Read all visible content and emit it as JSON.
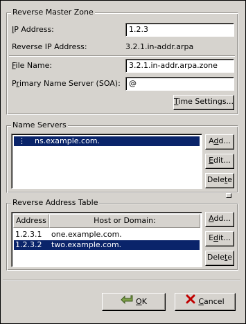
{
  "master_zone": {
    "title": "Reverse Master Zone",
    "ip_address": {
      "label_u": "I",
      "label_rest": "P Address:",
      "value": "1.2.3"
    },
    "reverse_ip": {
      "label": "Reverse IP Address:",
      "value": "3.2.1.in-addr.arpa"
    },
    "file_name": {
      "label_u": "F",
      "label_rest": "ile Name:",
      "value": "3.2.1.in-addr.arpa.zone"
    },
    "primary_ns": {
      "label_pre": "P",
      "label_u": "r",
      "label_rest": "imary Name Server (SOA):",
      "value": "@"
    },
    "time_settings": {
      "label_u": "T",
      "label_rest": "ime Settings..."
    }
  },
  "name_servers": {
    "title": "Name Servers",
    "items": [
      "ns.example.com."
    ],
    "add": {
      "label_pre": "A",
      "label_u": "d",
      "label_rest": "d..."
    },
    "edit": {
      "label_u": "E",
      "label_rest": "dit..."
    },
    "delete": {
      "label_pre": "Dele",
      "label_u": "t",
      "label_rest": "e"
    }
  },
  "address_table": {
    "title": "Reverse Address Table",
    "columns": [
      "Address",
      "Host or Domain:"
    ],
    "rows": [
      {
        "address": "1.2.3.1",
        "host": "one.example.com."
      },
      {
        "address": "1.2.3.2",
        "host": "two.example.com."
      }
    ],
    "add": {
      "label_u": "A",
      "label_rest": "dd..."
    },
    "edit": {
      "label_pre": "E",
      "label_u": "d",
      "label_rest": "it..."
    },
    "delete": {
      "label_pre": "Dele",
      "label_u": "t",
      "label_rest": "e"
    }
  },
  "footer": {
    "ok": {
      "label_u": "O",
      "label_rest": "K",
      "icon": "ok-icon"
    },
    "cancel": {
      "label_u": "C",
      "label_rest": "ancel",
      "icon": "cancel-icon"
    }
  },
  "colors": {
    "selection": "#0a246a",
    "background": "#d6d3ce"
  }
}
